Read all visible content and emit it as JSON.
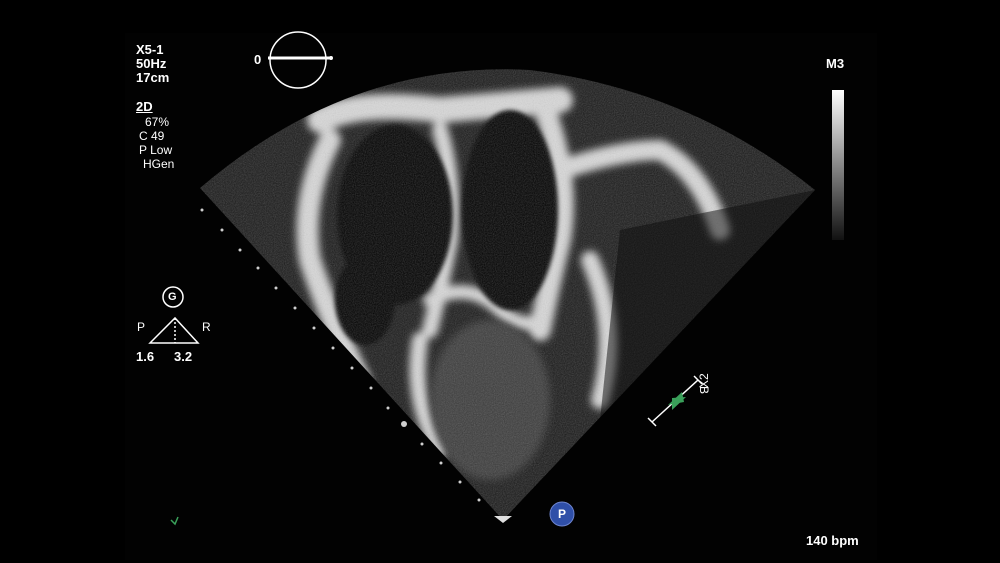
{
  "probe": {
    "name": "X5-1",
    "frequency": "50Hz",
    "depth": "17cm"
  },
  "mode": {
    "label": "2D",
    "gain": "67%",
    "compress": "C 49",
    "power": "P Low",
    "gen": "HGen"
  },
  "rotation": {
    "angle": "0"
  },
  "map": {
    "label": "M3"
  },
  "orientation": {
    "g_label": "G",
    "p_label": "P",
    "r_label": "R",
    "left_value": "1.6",
    "right_value": "3.2"
  },
  "plane": {
    "x_label": "X2",
    "b_label": "B"
  },
  "marker": {
    "label": "P"
  },
  "heart_rate": {
    "value": "140 bpm"
  },
  "colors": {
    "background": "#000000",
    "text": "#ffffff",
    "marker_blue": "#2f4fa8",
    "plane_green": "#3aa05a"
  }
}
